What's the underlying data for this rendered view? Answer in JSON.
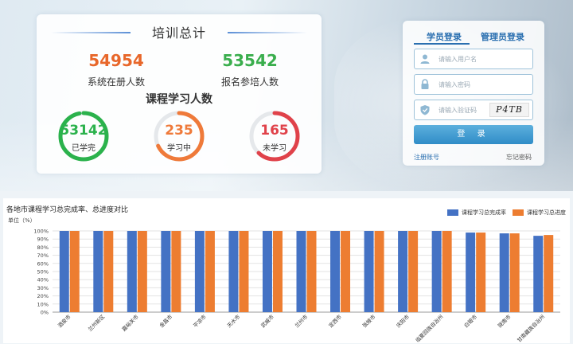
{
  "stats": {
    "title": "培训总计",
    "registered": {
      "value": "54954",
      "label": "系统在册人数",
      "color": "#e8672a"
    },
    "enrolled": {
      "value": "53542",
      "label": "报名参培人数",
      "color": "#3aae4d"
    },
    "course_title": "课程学习人数",
    "rings": [
      {
        "value": "53142",
        "label": "已学完",
        "color": "#2bb24c",
        "progress": 0.97
      },
      {
        "value": "235",
        "label": "学习中",
        "color": "#ef7a3a",
        "progress": 0.68
      },
      {
        "value": "165",
        "label": "未学习",
        "color": "#e0424a",
        "progress": 0.62
      }
    ]
  },
  "login": {
    "tab_student": "学员登录",
    "tab_admin": "管理员登录",
    "username_placeholder": "请输入用户名",
    "password_placeholder": "请输入密码",
    "captcha_placeholder": "请输入验证码",
    "captcha_text": "P4TB",
    "login_button": "登 录",
    "register_link": "注册账号",
    "forgot_link": "忘记密码"
  },
  "chart_data": {
    "type": "bar",
    "title": "各地市课程学习总完成率、总进度对比",
    "unit_label": "单位（%）",
    "categories": [
      "酒泉市",
      "兰州新区",
      "嘉峪关市",
      "金昌市",
      "平凉市",
      "天水市",
      "武威市",
      "兰州市",
      "定西市",
      "张掖市",
      "庆阳市",
      "临夏回族自治州",
      "白银市",
      "陇南市",
      "甘南藏族自治州"
    ],
    "series": [
      {
        "name": "课程学习总完成率",
        "color": "#4472c4",
        "values": [
          100,
          100,
          100,
          100,
          100,
          100,
          100,
          100,
          100,
          100,
          100,
          100,
          98,
          97,
          94
        ]
      },
      {
        "name": "课程学习总进度",
        "color": "#ed7d31",
        "values": [
          100,
          100,
          100,
          100,
          100,
          100,
          100,
          100,
          100,
          100,
          100,
          100,
          98,
          97,
          95
        ]
      }
    ],
    "ylim": [
      0,
      100
    ],
    "yticks": [
      "0%",
      "10%",
      "20%",
      "30%",
      "40%",
      "50%",
      "60%",
      "70%",
      "80%",
      "90%",
      "100%"
    ],
    "legend_position": "top-right",
    "grid": true
  }
}
